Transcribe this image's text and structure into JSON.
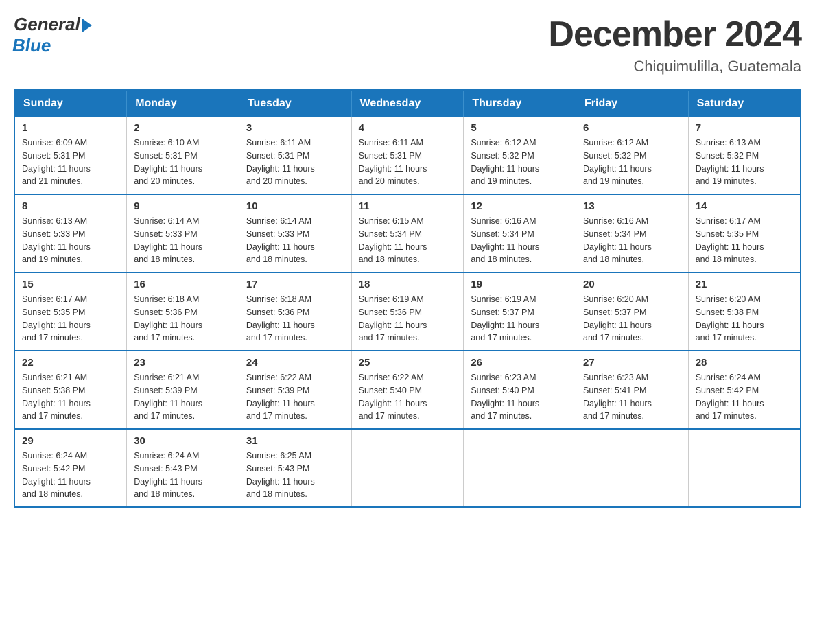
{
  "logo": {
    "general": "General",
    "blue": "Blue"
  },
  "title": "December 2024",
  "location": "Chiquimulilla, Guatemala",
  "headers": [
    "Sunday",
    "Monday",
    "Tuesday",
    "Wednesday",
    "Thursday",
    "Friday",
    "Saturday"
  ],
  "weeks": [
    [
      {
        "day": "1",
        "sunrise": "6:09 AM",
        "sunset": "5:31 PM",
        "daylight": "11 hours and 21 minutes."
      },
      {
        "day": "2",
        "sunrise": "6:10 AM",
        "sunset": "5:31 PM",
        "daylight": "11 hours and 20 minutes."
      },
      {
        "day": "3",
        "sunrise": "6:11 AM",
        "sunset": "5:31 PM",
        "daylight": "11 hours and 20 minutes."
      },
      {
        "day": "4",
        "sunrise": "6:11 AM",
        "sunset": "5:31 PM",
        "daylight": "11 hours and 20 minutes."
      },
      {
        "day": "5",
        "sunrise": "6:12 AM",
        "sunset": "5:32 PM",
        "daylight": "11 hours and 19 minutes."
      },
      {
        "day": "6",
        "sunrise": "6:12 AM",
        "sunset": "5:32 PM",
        "daylight": "11 hours and 19 minutes."
      },
      {
        "day": "7",
        "sunrise": "6:13 AM",
        "sunset": "5:32 PM",
        "daylight": "11 hours and 19 minutes."
      }
    ],
    [
      {
        "day": "8",
        "sunrise": "6:13 AM",
        "sunset": "5:33 PM",
        "daylight": "11 hours and 19 minutes."
      },
      {
        "day": "9",
        "sunrise": "6:14 AM",
        "sunset": "5:33 PM",
        "daylight": "11 hours and 18 minutes."
      },
      {
        "day": "10",
        "sunrise": "6:14 AM",
        "sunset": "5:33 PM",
        "daylight": "11 hours and 18 minutes."
      },
      {
        "day": "11",
        "sunrise": "6:15 AM",
        "sunset": "5:34 PM",
        "daylight": "11 hours and 18 minutes."
      },
      {
        "day": "12",
        "sunrise": "6:16 AM",
        "sunset": "5:34 PM",
        "daylight": "11 hours and 18 minutes."
      },
      {
        "day": "13",
        "sunrise": "6:16 AM",
        "sunset": "5:34 PM",
        "daylight": "11 hours and 18 minutes."
      },
      {
        "day": "14",
        "sunrise": "6:17 AM",
        "sunset": "5:35 PM",
        "daylight": "11 hours and 18 minutes."
      }
    ],
    [
      {
        "day": "15",
        "sunrise": "6:17 AM",
        "sunset": "5:35 PM",
        "daylight": "11 hours and 17 minutes."
      },
      {
        "day": "16",
        "sunrise": "6:18 AM",
        "sunset": "5:36 PM",
        "daylight": "11 hours and 17 minutes."
      },
      {
        "day": "17",
        "sunrise": "6:18 AM",
        "sunset": "5:36 PM",
        "daylight": "11 hours and 17 minutes."
      },
      {
        "day": "18",
        "sunrise": "6:19 AM",
        "sunset": "5:36 PM",
        "daylight": "11 hours and 17 minutes."
      },
      {
        "day": "19",
        "sunrise": "6:19 AM",
        "sunset": "5:37 PM",
        "daylight": "11 hours and 17 minutes."
      },
      {
        "day": "20",
        "sunrise": "6:20 AM",
        "sunset": "5:37 PM",
        "daylight": "11 hours and 17 minutes."
      },
      {
        "day": "21",
        "sunrise": "6:20 AM",
        "sunset": "5:38 PM",
        "daylight": "11 hours and 17 minutes."
      }
    ],
    [
      {
        "day": "22",
        "sunrise": "6:21 AM",
        "sunset": "5:38 PM",
        "daylight": "11 hours and 17 minutes."
      },
      {
        "day": "23",
        "sunrise": "6:21 AM",
        "sunset": "5:39 PM",
        "daylight": "11 hours and 17 minutes."
      },
      {
        "day": "24",
        "sunrise": "6:22 AM",
        "sunset": "5:39 PM",
        "daylight": "11 hours and 17 minutes."
      },
      {
        "day": "25",
        "sunrise": "6:22 AM",
        "sunset": "5:40 PM",
        "daylight": "11 hours and 17 minutes."
      },
      {
        "day": "26",
        "sunrise": "6:23 AM",
        "sunset": "5:40 PM",
        "daylight": "11 hours and 17 minutes."
      },
      {
        "day": "27",
        "sunrise": "6:23 AM",
        "sunset": "5:41 PM",
        "daylight": "11 hours and 17 minutes."
      },
      {
        "day": "28",
        "sunrise": "6:24 AM",
        "sunset": "5:42 PM",
        "daylight": "11 hours and 17 minutes."
      }
    ],
    [
      {
        "day": "29",
        "sunrise": "6:24 AM",
        "sunset": "5:42 PM",
        "daylight": "11 hours and 18 minutes."
      },
      {
        "day": "30",
        "sunrise": "6:24 AM",
        "sunset": "5:43 PM",
        "daylight": "11 hours and 18 minutes."
      },
      {
        "day": "31",
        "sunrise": "6:25 AM",
        "sunset": "5:43 PM",
        "daylight": "11 hours and 18 minutes."
      },
      null,
      null,
      null,
      null
    ]
  ],
  "sunrise_label": "Sunrise:",
  "sunset_label": "Sunset:",
  "daylight_label": "Daylight:"
}
